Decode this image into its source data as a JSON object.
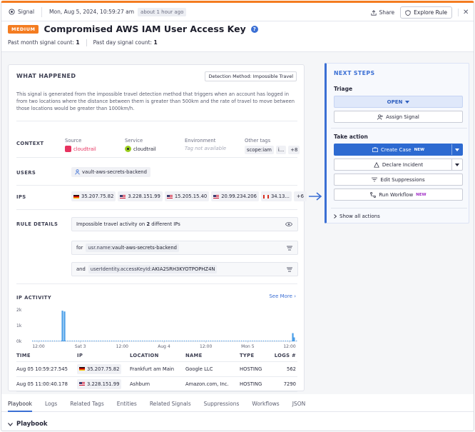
{
  "header": {
    "signal_label": "Signal",
    "timestamp": "Mon, Aug 5, 2024, 10:59:27 am",
    "relative_time": "about 1 hour ago",
    "share_label": "Share",
    "explore_rule_label": "Explore Rule",
    "close_glyph": "✕"
  },
  "signal": {
    "severity": "MEDIUM",
    "title": "Compromised AWS IAM User Access Key",
    "help_glyph": "?",
    "past_month_label": "Past month signal count:",
    "past_month_count": "1",
    "past_day_label": "Past day signal count:",
    "past_day_count": "1"
  },
  "what_happened": {
    "heading": "WHAT HAPPENED",
    "detection_method": "Detection Method: Impossible Travel",
    "description": "This signal is generated from the impossible travel detection method that triggers when an account has logged in from two locations where the distance between them is greater than 500km and the rate of travel to move between those locations would be greater than 1000km/h.",
    "context": {
      "label": "CONTEXT",
      "source_key": "Source",
      "source_value": "cloudtrail",
      "service_key": "Service",
      "service_value": "cloudtrail",
      "environment_key": "Environment",
      "environment_value": "Tag not available",
      "other_tags_key": "Other tags",
      "other_tag": "scope:iam",
      "other_tag_more": "i...",
      "other_tags_extra": "+8"
    },
    "users": {
      "label": "USERS",
      "value": "vault-aws-secrets-backend"
    },
    "ips": {
      "label": "IPS",
      "items": [
        {
          "ip": "35.207.75.82",
          "flag": "de"
        },
        {
          "ip": "3.228.151.99",
          "flag": "us"
        },
        {
          "ip": "15.205.15.40",
          "flag": "us"
        },
        {
          "ip": "20.99.234.206",
          "flag": "us"
        },
        {
          "ip": "34.13...",
          "flag": "ca"
        }
      ],
      "extra": "+6"
    },
    "rule_details": {
      "label": "RULE DETAILS",
      "line1_prefix": "Impossible travel activity on",
      "line1_count": "2",
      "line1_suffix": "different IPs",
      "line2_prefix": "for",
      "line2_key": "usr.name:",
      "line2_value": "vault-aws-secrets-backend",
      "line3_prefix": "and",
      "line3_key": "userIdentity.accessKeyId:",
      "line3_value": "AKIA2SRH3KYOTPOPHZ4N"
    },
    "ip_activity": {
      "label": "IP ACTIVITY",
      "see_more": "See More ›",
      "chart_data": {
        "type": "bar",
        "y_ticks": [
          "2k",
          "1k",
          "0k"
        ],
        "ylim": [
          0,
          2000
        ],
        "x_ticks": [
          "12:00",
          "Sat 3",
          "12:00",
          "Aug 4",
          "12:00",
          "Mon 5",
          "12:00"
        ],
        "spikes": [
          {
            "position": 0.112,
            "value": 1950
          },
          {
            "position": 0.12,
            "value": 1900
          },
          {
            "position": 0.985,
            "value": 520
          },
          {
            "position": 0.99,
            "value": 250
          }
        ]
      },
      "columns": [
        "TIME",
        "IP",
        "LOCATION",
        "NAME",
        "TYPE",
        "LOGS #"
      ],
      "rows": [
        {
          "time": "Aug 05 10:59:27.545",
          "ip": "35.207.75.82",
          "flag": "de",
          "location": "Frankfurt am Main",
          "name": "Google LLC",
          "type": "HOSTING",
          "logs": "562"
        },
        {
          "time": "Aug 05 11:00:40.178",
          "ip": "3.228.151.99",
          "flag": "us",
          "location": "Ashburn",
          "name": "Amazon.com, Inc.",
          "type": "HOSTING",
          "logs": "7290"
        }
      ]
    }
  },
  "next_steps": {
    "heading": "NEXT STEPS",
    "triage_label": "Triage",
    "status": "OPEN",
    "assign_signal": "Assign Signal",
    "take_action_label": "Take action",
    "create_case": "Create Case",
    "create_case_badge": "NEW",
    "declare_incident": "Declare Incident",
    "edit_suppressions": "Edit Suppressions",
    "run_workflow": "Run Workflow",
    "run_workflow_badge": "NEW",
    "show_all": "Show all actions"
  },
  "tabs": [
    "Playbook",
    "Logs",
    "Related Tags",
    "Entities",
    "Related Signals",
    "Suppressions",
    "Workflows",
    "JSON"
  ],
  "playbook": {
    "title": "Playbook"
  },
  "colors": {
    "accent": "#3b6fd4",
    "severity": "#f47c20",
    "bars": "#4a9ee8"
  }
}
